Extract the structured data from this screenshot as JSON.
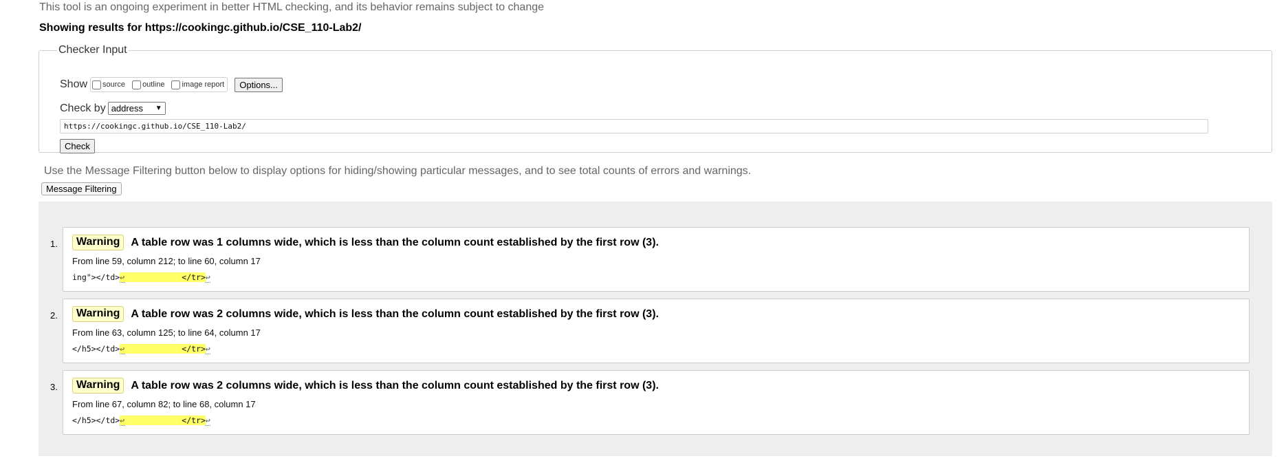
{
  "intro": "This tool is an ongoing experiment in better HTML checking, and its behavior remains subject to change",
  "showing": "Showing results for https://cookingc.github.io/CSE_110-Lab2/",
  "checker": {
    "legend": "Checker Input",
    "show_label": "Show",
    "options": [
      "source",
      "outline",
      "image report"
    ],
    "options_button": "Options...",
    "check_by_label": "Check by",
    "check_by_value": "address",
    "url_value": "https://cookingc.github.io/CSE_110-Lab2/",
    "check_button": "Check"
  },
  "filter_note": "Use the Message Filtering button below to display options for hiding/showing particular messages, and to see total counts of errors and warnings.",
  "filter_button": "Message Filtering",
  "messages": [
    {
      "num": "1.",
      "type": "Warning",
      "text": "A table row was 1 columns wide, which is less than the column count established by the first row (3).",
      "location": "From line 59, column 212; to line 60, column 17",
      "extract_pre": "ing\"></td>",
      "extract_hl_lf": "↩",
      "extract_hl": "            </tr>",
      "extract_post": "↩"
    },
    {
      "num": "2.",
      "type": "Warning",
      "text": "A table row was 2 columns wide, which is less than the column count established by the first row (3).",
      "location": "From line 63, column 125; to line 64, column 17",
      "extract_pre": "</h5></td>",
      "extract_hl_lf": "↩",
      "extract_hl": "            </tr>",
      "extract_post": "↩"
    },
    {
      "num": "3.",
      "type": "Warning",
      "text": "A table row was 2 columns wide, which is less than the column count established by the first row (3).",
      "location": "From line 67, column 82; to line 68, column 17",
      "extract_pre": "</h5></td>",
      "extract_hl_lf": "↩",
      "extract_hl": "            </tr>",
      "extract_post": "↩"
    }
  ]
}
